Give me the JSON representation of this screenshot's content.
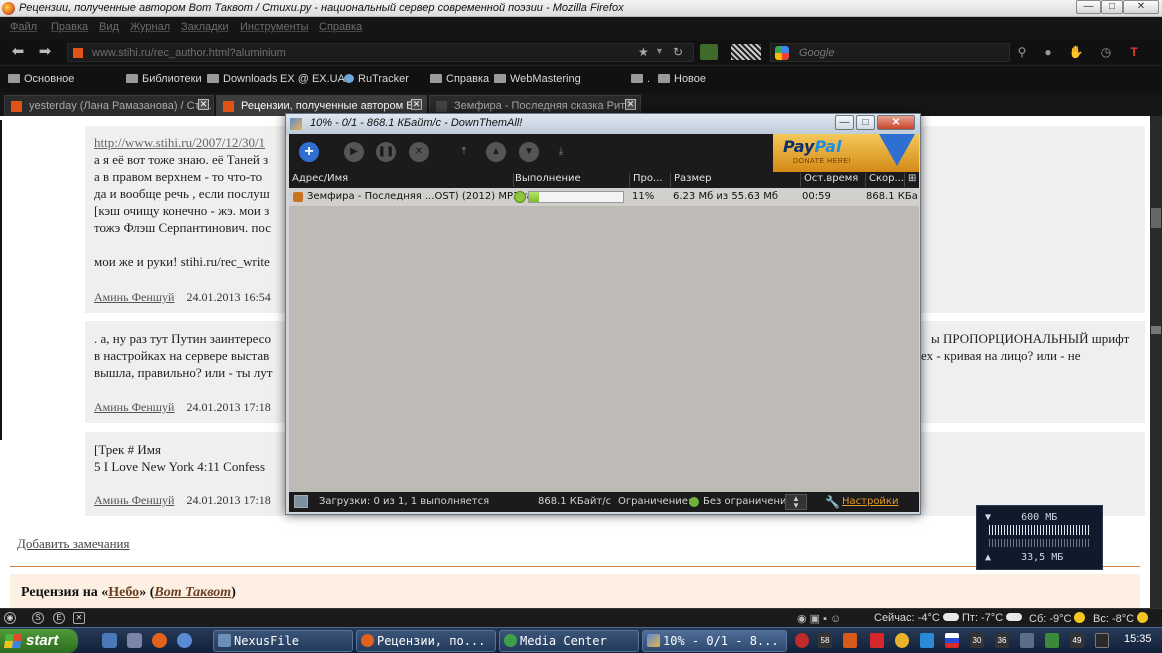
{
  "window": {
    "title": "Рецензии, полученные автором Вот Таквот / Стихи.ру - национальный сервер современной поэзии - Mozilla Firefox",
    "min": "—",
    "max": "□",
    "close": "✕"
  },
  "menu": [
    "Файл",
    "Правка",
    "Вид",
    "Журнал",
    "Закладки",
    "Инструменты",
    "Справка"
  ],
  "nav": {
    "url": "www.stihi.ru/rec_author.html?aluminium",
    "search_placeholder": "Google"
  },
  "bookmarks": [
    "Основное",
    "Библиотеки",
    "Downloads",
    "EX @ EX.UA",
    "RuTracker",
    "Справка",
    "WebMastering",
    ".",
    "Новое"
  ],
  "tabs": [
    {
      "label": "yesterday (Лана Рамазанова) / Сти...",
      "active": false
    },
    {
      "label": "Рецензии, полученные автором В...",
      "active": true
    },
    {
      "label": "Земфира - Последняя сказка Рит...",
      "active": false
    }
  ],
  "page": {
    "reviews": [
      {
        "lines": [
          "http://www.stihi.ru/2007/12/30/1",
          "а я её вот тоже знаю. её Таней з",
          "а в правом верхнем - то что-то",
          "да и вообще речь , если послуш",
          "[кэш очищу конечно - жэ. мои з",
          "тожэ Флэш Серпантинович. пос",
          "",
          "мои же и руки! stihi.ru/rec_write"
        ],
        "author": "Аминь Феншуй",
        "date": "24.01.2013 16:54"
      },
      {
        "lines": [
          ". а, ну раз тут Путин заинтересо",
          "в настройках на сервере выстав",
          "вышла, правильно? или - ты лут"
        ],
        "right_lines": [
          "ы ПРОПОРЦИОНАЛЬНЫЙ шрифт",
          "ех - кривая на лицо? или - не"
        ],
        "author": "Аминь Феншуй",
        "date": "24.01.2013 17:18"
      },
      {
        "lines": [
          "[Трек # Имя",
          "5 I Love New York 4:11 Confess"
        ],
        "author": "Аминь Феншуй",
        "date": "24.01.2013 17:18"
      }
    ],
    "add_notes": "Добавить замечания",
    "recenzia_prefix": "Рецензия на «",
    "recenzia_work": "Небо",
    "recenzia_mid": "» (",
    "recenzia_author": "Вот Таквот",
    "recenzia_suffix": ")"
  },
  "dta": {
    "title": "10% - 0/1 - 868.1 КБайт/с - DownThemAll!",
    "paypal": {
      "pay": "Pay",
      "pal": "Pal",
      "donate": "DONATE HERE!"
    },
    "columns": [
      "Адрес/Имя",
      "Выполнение",
      "Про...",
      "Размер",
      "Ост.время",
      "Скор..."
    ],
    "rows": [
      {
        "name": "Земфира - Последняя ...OST) (2012) MP3.rar",
        "progress": 0.11,
        "percent": "11%",
        "size": "6.23 Мб из 55.63 Мб",
        "remaining": "00:59",
        "speed": "868.1 КБа..."
      }
    ],
    "status": {
      "downloads": "Загрузки: 0 из 1, 1 выполняется",
      "speed": "868.1 КБайт/с",
      "limit_label": "Ограничение:",
      "limit_value": "Без ограничений",
      "settings": "Настройки"
    }
  },
  "memwidget": {
    "top": "600 МБ",
    "bottom": "33,5 МБ"
  },
  "weather": [
    "Сейчас: -4°С",
    "Пт: -7°С",
    "Сб: -9°С",
    "Вс: -8°С"
  ],
  "taskbar": {
    "start": "start",
    "tasks": [
      "NexusFile",
      "Рецензии, по...",
      "Media Center",
      "10% - 0/1 - 8..."
    ],
    "tray_numbers": [
      "58",
      "30",
      "36",
      "49"
    ],
    "clock": "15:35"
  },
  "colors": {
    "accent_orange": "#e2531a",
    "progress_green": "#7fbf27",
    "dta_dark": "#1b1b1b"
  }
}
